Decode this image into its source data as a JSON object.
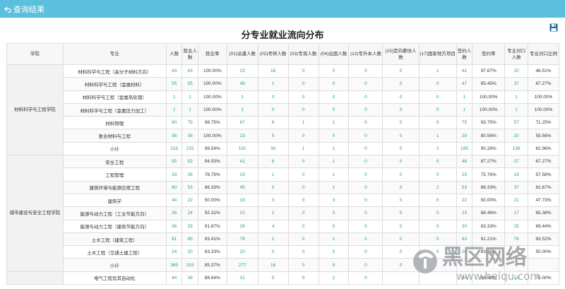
{
  "topbar": {
    "back_label": "查询结果",
    "color": "#5bc0de"
  },
  "title": "分专业就业流向分布",
  "icons": {
    "back": "back-arrow-icon",
    "save": "save-icon"
  },
  "headers": [
    "学院",
    "专业",
    "人数",
    "就业人数",
    "就业率",
    "(01)派遣人数",
    "(02)考研人数",
    "(03)专双人数",
    "(04)出国人数",
    "(12)专升本人数",
    "(15)定向委培人数",
    "(17)国家地方项目",
    "签约人数",
    "签约率",
    "专业对口人数",
    "专业对口比例"
  ],
  "colleges": [
    {
      "name": "材料科学与工程学院",
      "rowspan": 7
    },
    {
      "name": "城市建设与安全工程学院",
      "rowspan": 9
    }
  ],
  "rows": [
    [
      "材料科学与工程（高分子材料方向）",
      "43",
      "43",
      "100.00%",
      "23",
      "18",
      "0",
      "0",
      "0",
      "0",
      "1",
      "42",
      "97.67%",
      "20",
      "46.51%"
    ],
    [
      "材料科学与工程（金属材料）",
      "55",
      "55",
      "100.00%",
      "46",
      "1",
      "0",
      "0",
      "0",
      "0",
      "0",
      "47",
      "85.45%",
      "37",
      "67.27%"
    ],
    [
      "材料科学与工程（金属热处理）",
      "1",
      "1",
      "100.00%",
      "1",
      "0",
      "0",
      "0",
      "0",
      "0",
      "0",
      "1",
      "100.00%",
      "1",
      "100.00%"
    ],
    [
      "材料科学与工程（金属压力加工）",
      "1",
      "1",
      "100.00%",
      "1",
      "0",
      "0",
      "0",
      "0",
      "0",
      "0",
      "1",
      "100.00%",
      "1",
      "100.00%"
    ],
    [
      "材料物理",
      "80",
      "79",
      "98.75%",
      "67",
      "6",
      "1",
      "1",
      "0",
      "0",
      "0",
      "75",
      "93.75%",
      "57",
      "71.25%"
    ],
    [
      "复合材料与工程",
      "36",
      "36",
      "100.00%",
      "23",
      "5",
      "0",
      "0",
      "0",
      "0",
      "1",
      "29",
      "80.56%",
      "20",
      "55.56%"
    ],
    [
      "小计",
      "216",
      "215",
      "99.54%",
      "161",
      "30",
      "1",
      "1",
      "0",
      "0",
      "2",
      "195",
      "90.28%",
      "136",
      "62.96%"
    ],
    [
      "安全工程",
      "55",
      "52",
      "94.55%",
      "41",
      "6",
      "0",
      "1",
      "0",
      "0",
      "0",
      "48",
      "87.27%",
      "37",
      "67.27%"
    ],
    [
      "工程管理",
      "33",
      "26",
      "78.79%",
      "23",
      "1",
      "0",
      "1",
      "0",
      "0",
      "0",
      "25",
      "75.76%",
      "19",
      "57.58%"
    ],
    [
      "建筑环境与能源应用工程",
      "60",
      "53",
      "88.33%",
      "45",
      "5",
      "0",
      "1",
      "0",
      "0",
      "2",
      "53",
      "88.33%",
      "37",
      "61.67%"
    ],
    [
      "建筑学",
      "44",
      "22",
      "50.00%",
      "19",
      "0",
      "0",
      "3",
      "0",
      "0",
      "0",
      "22",
      "50.00%",
      "21",
      "47.73%"
    ],
    [
      "能源与动力工程（工业节能方向）",
      "26",
      "24",
      "92.31%",
      "21",
      "2",
      "0",
      "0",
      "0",
      "0",
      "0",
      "23",
      "88.46%",
      "17",
      "65.38%"
    ],
    [
      "能源与动力工程（建筑节能方向）",
      "36",
      "33",
      "91.67%",
      "29",
      "4",
      "0",
      "0",
      "0",
      "0",
      "0",
      "30",
      "83.33%",
      "25",
      "69.44%"
    ],
    [
      "土木工程（建筑工程）",
      "91",
      "85",
      "93.41%",
      "79",
      "1",
      "0",
      "1",
      "0",
      "0",
      "0",
      "83",
      "91.21%",
      "76",
      "83.52%"
    ],
    [
      "土木工程（交通土建工程）",
      "24",
      "20",
      "83.33%",
      "20",
      "0",
      "0",
      "0",
      "0",
      "0",
      "0",
      "20",
      "83.33%",
      "",
      "50.00%"
    ],
    [
      "小计",
      "369",
      "315",
      "85.37%",
      "277",
      "16",
      "0",
      "9",
      "0",
      "0",
      "",
      "",
      "",
      "",
      ""
    ],
    [
      "电气工程及其自动化",
      "44",
      "39",
      "88.64%",
      "31",
      "5",
      "0",
      "2",
      "0",
      "",
      "",
      "39",
      "88.64%",
      "33",
      "75.00%"
    ]
  ],
  "watermark": {
    "logo_text": "黑区网络",
    "url_text": "www.heiqu.com"
  }
}
